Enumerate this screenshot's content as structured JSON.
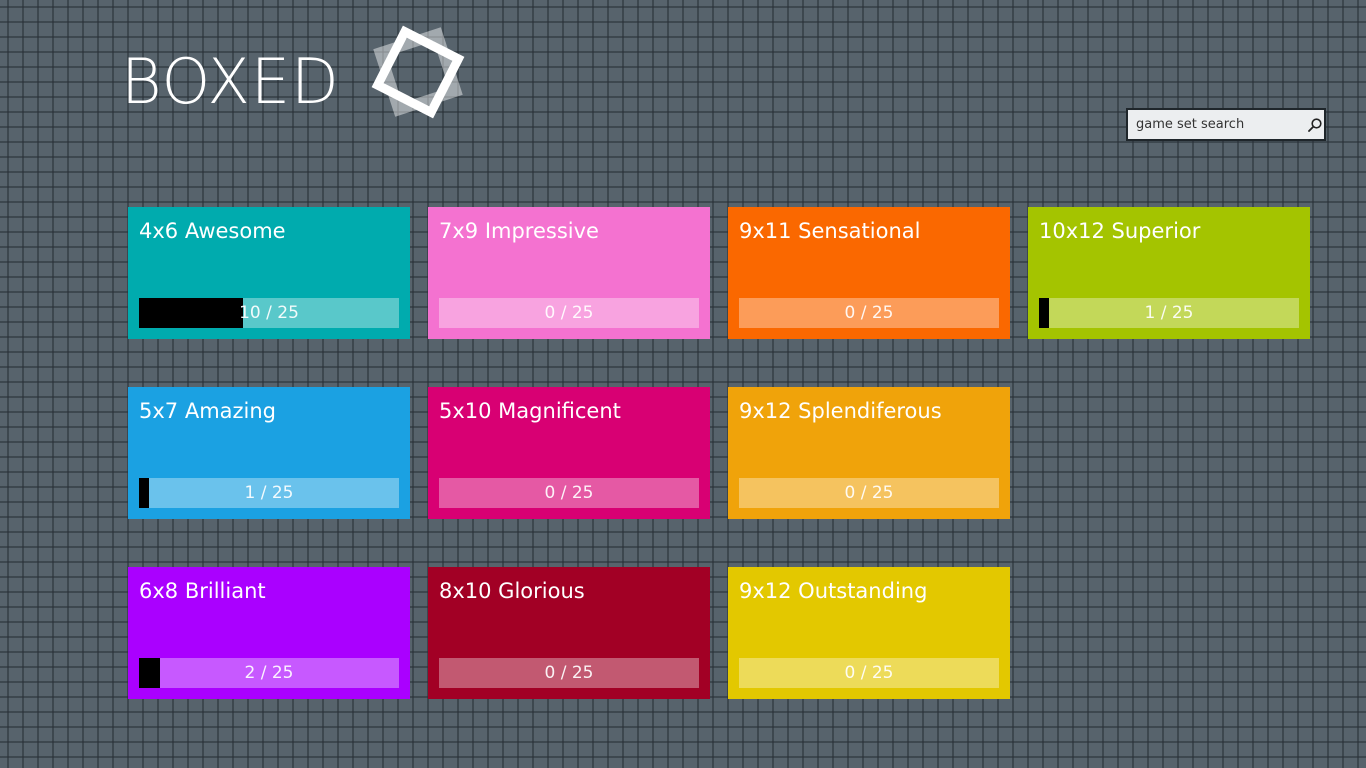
{
  "app": {
    "title": "BOXED"
  },
  "search": {
    "placeholder": "game set search",
    "icon": "search-icon"
  },
  "colors": {
    "background": "#57636c",
    "grid_line": "#3e484f"
  },
  "game_sets": [
    {
      "name": "4x6 Awesome",
      "progress_text": "10 / 25",
      "solved": 10,
      "total": 25,
      "color": "#00abae"
    },
    {
      "name": "7x9 Impressive",
      "progress_text": "0 / 25",
      "solved": 0,
      "total": 25,
      "color": "#f472d0"
    },
    {
      "name": "9x11 Sensational",
      "progress_text": "0 / 25",
      "solved": 0,
      "total": 25,
      "color": "#fa6800"
    },
    {
      "name": "10x12 Superior",
      "progress_text": "1 / 25",
      "solved": 1,
      "total": 25,
      "color": "#a4c400"
    },
    {
      "name": "5x7 Amazing",
      "progress_text": "1 / 25",
      "solved": 1,
      "total": 25,
      "color": "#1ba1e2"
    },
    {
      "name": "5x10 Magnificent",
      "progress_text": "0 / 25",
      "solved": 0,
      "total": 25,
      "color": "#d80073"
    },
    {
      "name": "9x12 Splendiferous",
      "progress_text": "0 / 25",
      "solved": 0,
      "total": 25,
      "color": "#f0a30a"
    },
    {
      "name": "6x8 Brilliant",
      "progress_text": "2 / 25",
      "solved": 2,
      "total": 25,
      "color": "#aa00ff"
    },
    {
      "name": "8x10 Glorious",
      "progress_text": "0 / 25",
      "solved": 0,
      "total": 25,
      "color": "#a20025"
    },
    {
      "name": "9x12 Outstanding",
      "progress_text": "0 / 25",
      "solved": 0,
      "total": 25,
      "color": "#e3c800"
    }
  ]
}
